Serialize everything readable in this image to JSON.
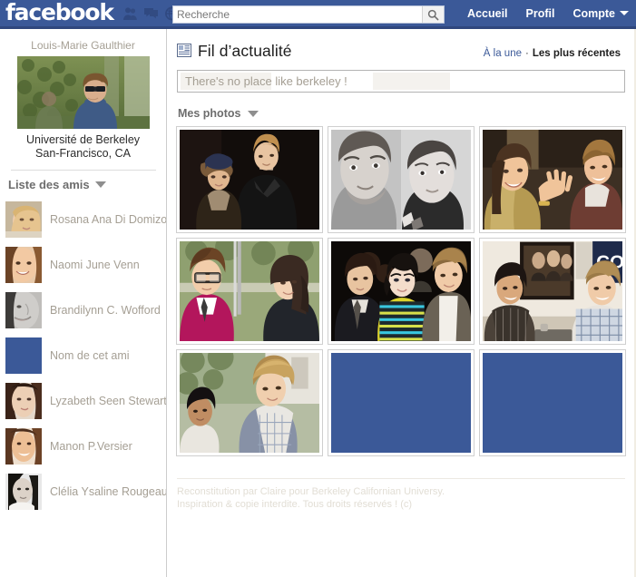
{
  "topbar": {
    "brand": "facebook",
    "icons": [
      {
        "name": "friends-icon",
        "label": "Demandes d'amis"
      },
      {
        "name": "messages-icon",
        "label": "Messages"
      },
      {
        "name": "notifications-globe-icon",
        "label": "Notifications"
      }
    ],
    "search": {
      "placeholder": "Recherche",
      "value": "",
      "button_icon": "search-icon"
    },
    "links": [
      {
        "label": "Accueil"
      },
      {
        "label": "Profil"
      },
      {
        "label": "Compte",
        "has_caret": true
      }
    ],
    "bg_color": "#3b5998",
    "border_color": "#2f477d"
  },
  "sidebar": {
    "profile": {
      "name": "Louis-Marie Gaulthier",
      "school": "Université de Berkeley",
      "location": "San-Francisco, CA"
    },
    "friends_header": {
      "label": "Liste des amis",
      "caret_icon": "triangle-down-icon"
    },
    "friends": [
      {
        "name": "Rosana Ana Di Domizo",
        "avatar": "photo-blonde-woman"
      },
      {
        "name": "Naomi June Venn",
        "avatar": "photo-smiling-woman"
      },
      {
        "name": "Brandilynn C. Wofford",
        "avatar": "photo-bw-face"
      },
      {
        "name": "Nom de cet ami",
        "avatar": "placeholder-blue"
      },
      {
        "name": "Lyzabeth Seen Stewart",
        "avatar": "photo-dark-hair-woman"
      },
      {
        "name": "Manon P.Versier",
        "avatar": "photo-young-woman"
      },
      {
        "name": "Clélia Ysaline Rougeau",
        "avatar": "photo-bw-portrait"
      }
    ]
  },
  "main": {
    "feed": {
      "icon": "newsfeed-icon",
      "title": "Fil d’actualité",
      "filters": [
        {
          "label": "À la une",
          "active": false
        },
        {
          "label": "·",
          "separator": true
        },
        {
          "label": "Les plus récentes",
          "active": true
        }
      ]
    },
    "status": {
      "text": "There's no place like berkeley !",
      "placeholder": "There's no place like berkeley !"
    },
    "photos_section": {
      "label": "Mes photos",
      "caret_icon": "triangle-down-icon",
      "columns": 3,
      "items": [
        {
          "id": 1,
          "type": "photo",
          "caption": "photo-couple-beanie-night"
        },
        {
          "id": 2,
          "type": "photo",
          "caption": "photo-bw-selfie-couple"
        },
        {
          "id": 3,
          "type": "photo",
          "caption": "photo-party-wave-couple"
        },
        {
          "id": 4,
          "type": "photo",
          "caption": "photo-glasses-pink-sweater-pair"
        },
        {
          "id": 5,
          "type": "photo",
          "caption": "photo-trio-premiere-night"
        },
        {
          "id": 6,
          "type": "photo",
          "caption": "photo-comiccon-panel"
        },
        {
          "id": 7,
          "type": "photo",
          "caption": "photo-two-guys-outdoors"
        },
        {
          "id": 8,
          "type": "placeholder",
          "caption": "placeholder-blue"
        },
        {
          "id": 9,
          "type": "placeholder",
          "caption": "placeholder-blue"
        }
      ]
    },
    "footer": {
      "line1": "Reconstitution par Claire pour Berkeley Californian Universy.",
      "line2": "Inspiration & copie interdite. Tous droits réservés ! (c)"
    }
  },
  "colors": {
    "brand_blue": "#3b5998",
    "dark_blue": "#2f477d",
    "link_blue": "#3b5998",
    "muted_text": "#a59f94",
    "footer_text": "#e2ded5"
  }
}
